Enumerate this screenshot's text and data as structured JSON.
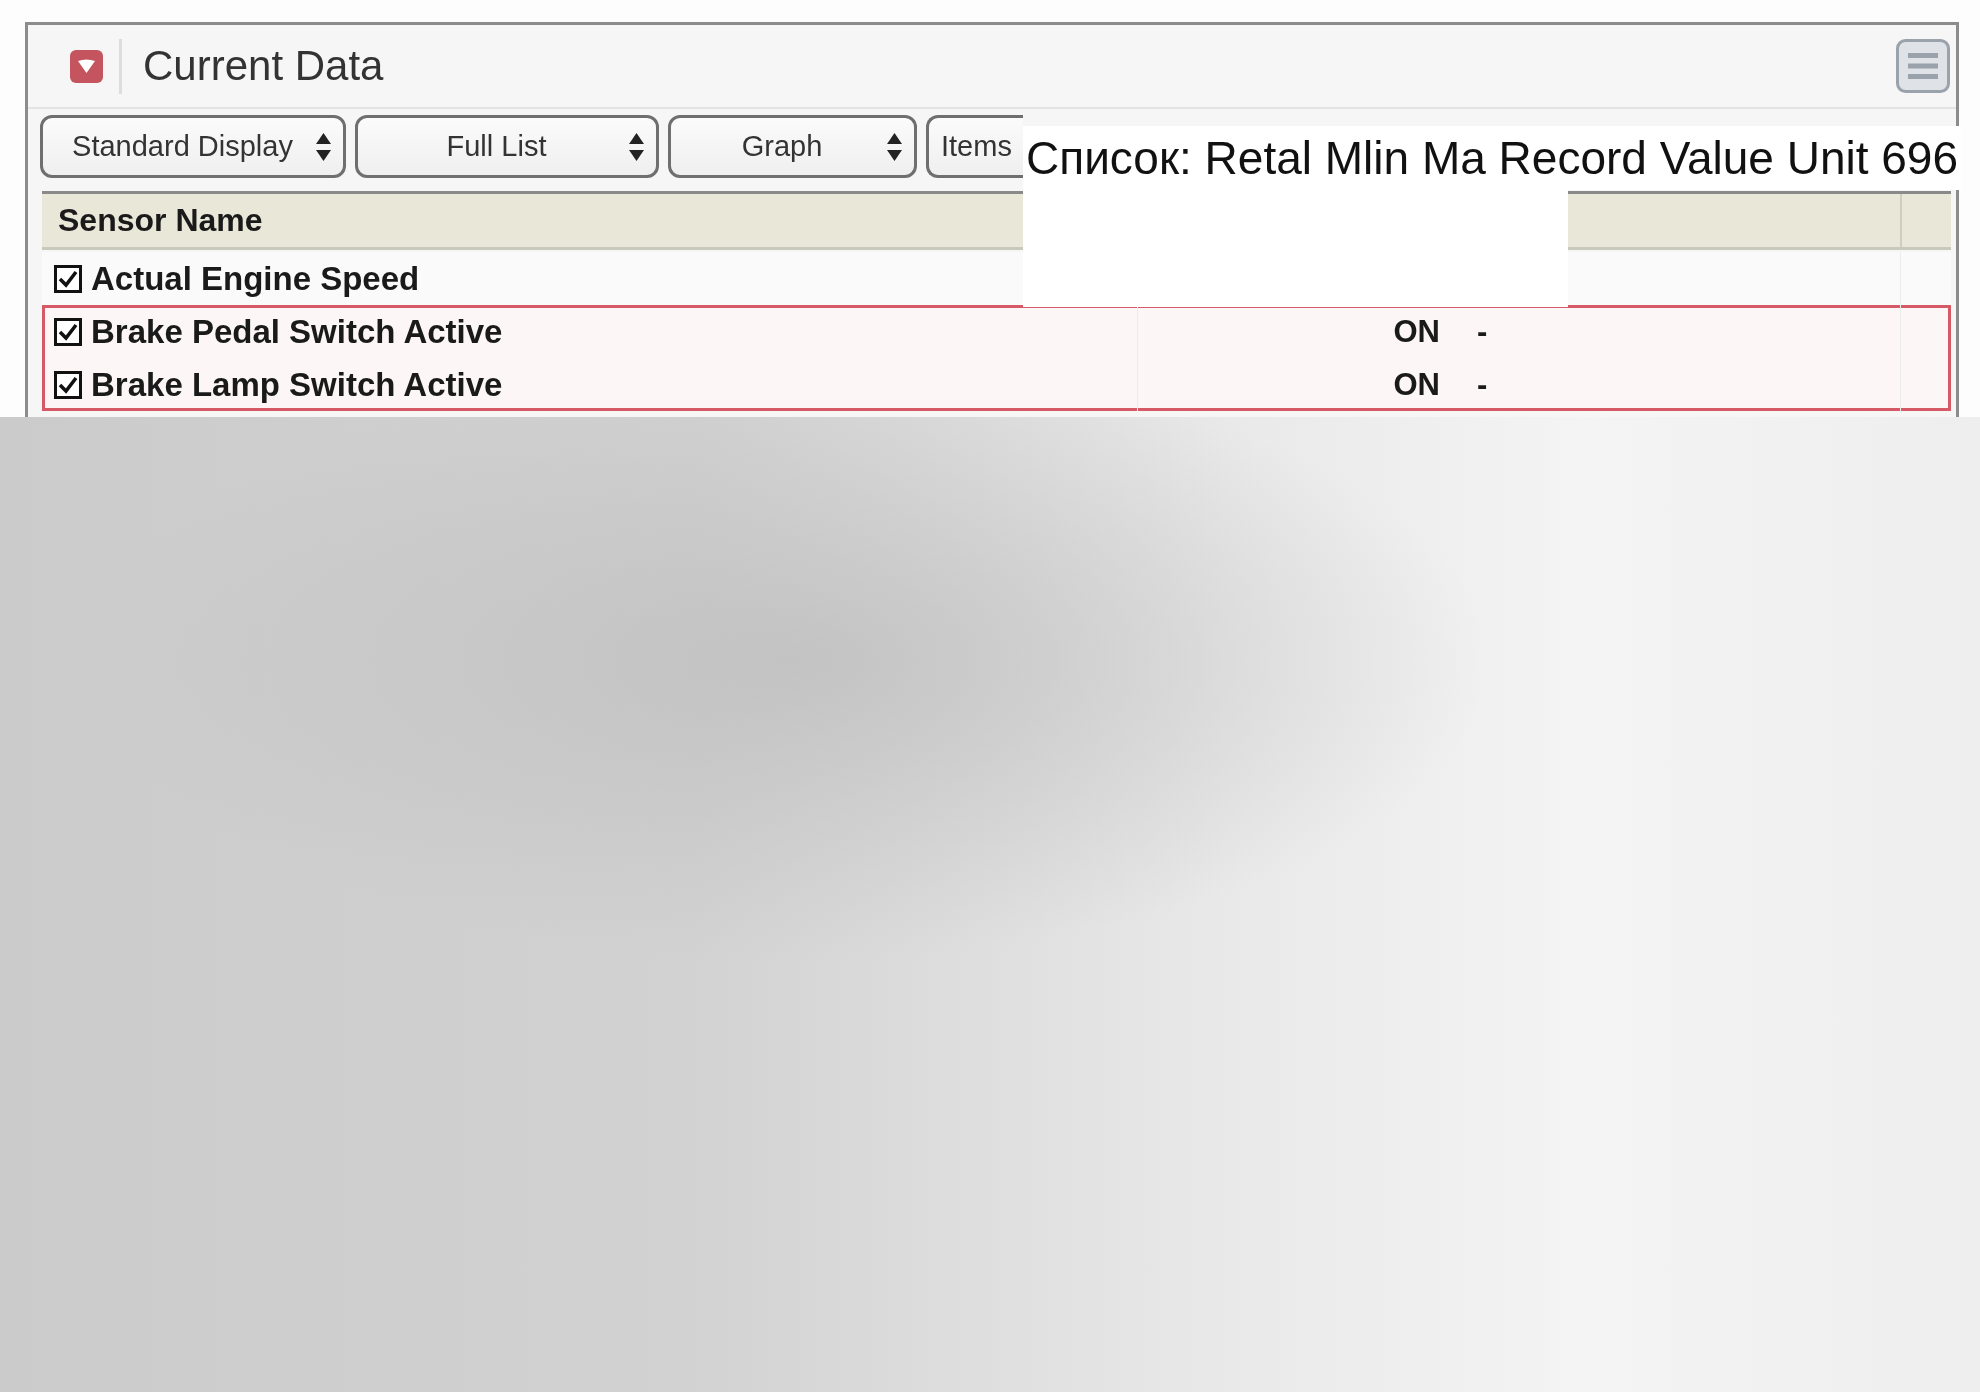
{
  "panel": {
    "title": "Current Data"
  },
  "toolbar": [
    {
      "kind": "select",
      "label": "Standard Display"
    },
    {
      "kind": "select",
      "label": "Full List"
    },
    {
      "kind": "select",
      "label": "Graph"
    },
    {
      "kind": "button",
      "label": "Items"
    }
  ],
  "table": {
    "columns": [
      "Sensor Name"
    ],
    "rows": [
      {
        "checked": true,
        "highlighted": false,
        "name": "Actual Engine Speed"
      },
      {
        "checked": true,
        "highlighted": true,
        "name": "Brake Pedal Switch Active",
        "column_2": "ON",
        "column_3": "-"
      },
      {
        "checked": true,
        "highlighted": true,
        "name": "Brake Lamp Switch Active",
        "column_2": "ON",
        "column_3": "-"
      }
    ]
  },
  "overlay": {
    "text": "Список: Retal Mlin Ma Record Value Unit 696"
  }
}
